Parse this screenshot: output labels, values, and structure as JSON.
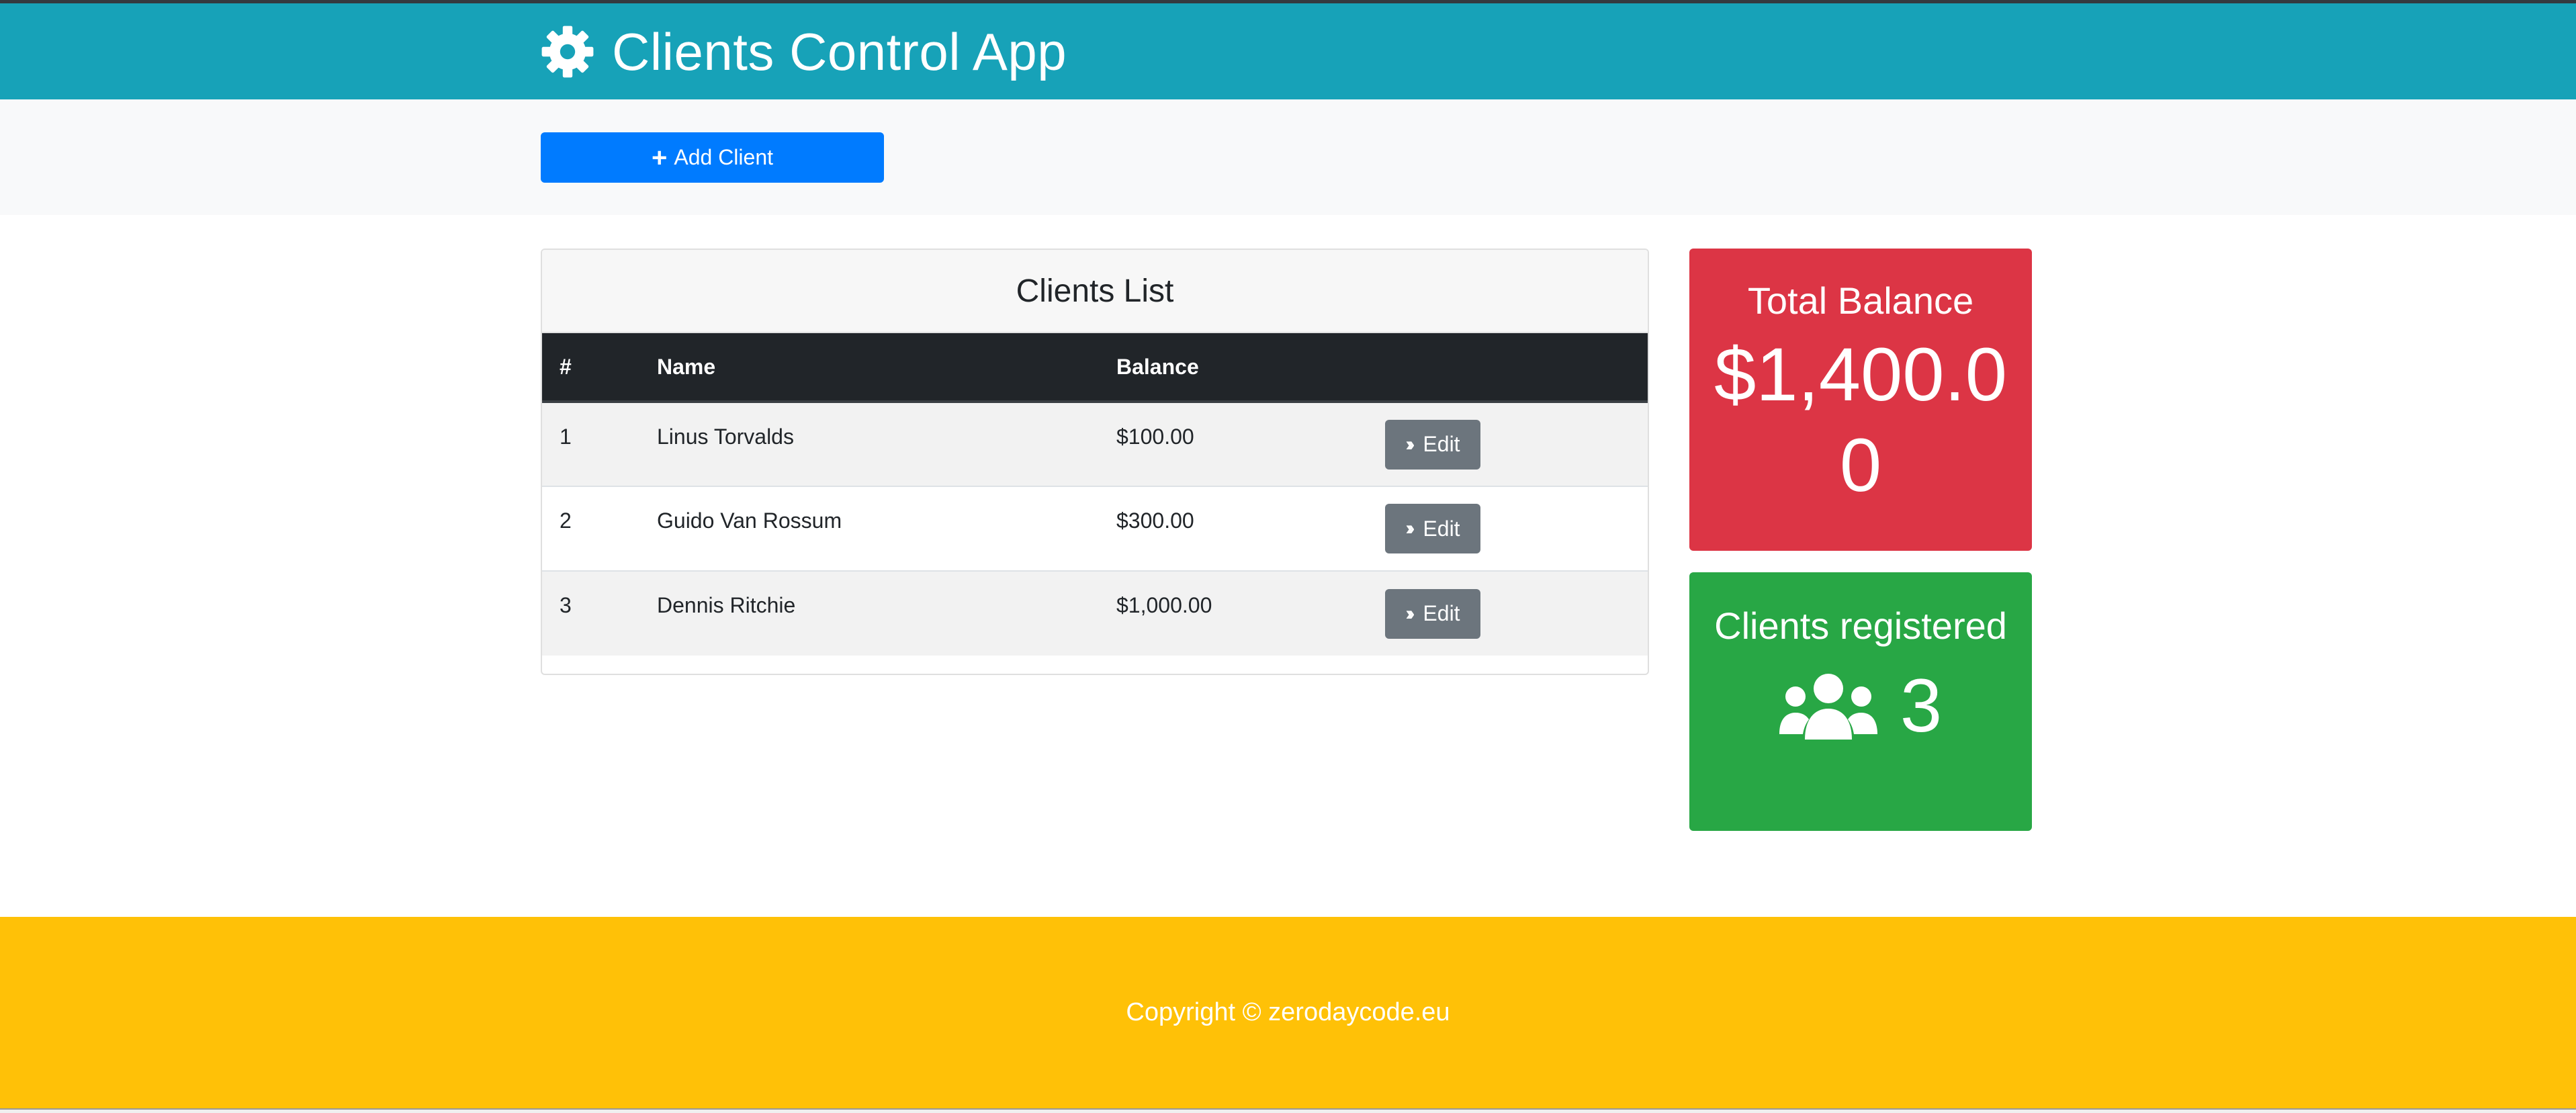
{
  "header": {
    "title": "Clients Control App",
    "icon": "gear-icon"
  },
  "actions": {
    "add_client_label": "Add Client",
    "add_icon": "plus-icon"
  },
  "clients_card": {
    "title": "Clients List",
    "columns": [
      "#",
      "Name",
      "Balance",
      ""
    ],
    "rows": [
      {
        "num": "1",
        "name": "Linus Torvalds",
        "balance": "$100.00",
        "edit_label": "Edit"
      },
      {
        "num": "2",
        "name": "Guido Van Rossum",
        "balance": "$300.00",
        "edit_label": "Edit"
      },
      {
        "num": "3",
        "name": "Dennis Ritchie",
        "balance": "$1,000.00",
        "edit_label": "Edit"
      }
    ]
  },
  "stats": {
    "total_balance_title": "Total Balance",
    "total_balance_value": "$1,400.00",
    "clients_title": "Clients registered",
    "clients_count": "3",
    "clients_icon": "users-icon"
  },
  "footer": {
    "copyright": "Copyright © zerodaycode.eu"
  },
  "colors": {
    "header": "#17a2b8",
    "primary": "#007bff",
    "danger": "#dc3545",
    "success": "#28a745",
    "warning": "#ffc107",
    "dark": "#212529",
    "secondary": "#6c757d"
  }
}
